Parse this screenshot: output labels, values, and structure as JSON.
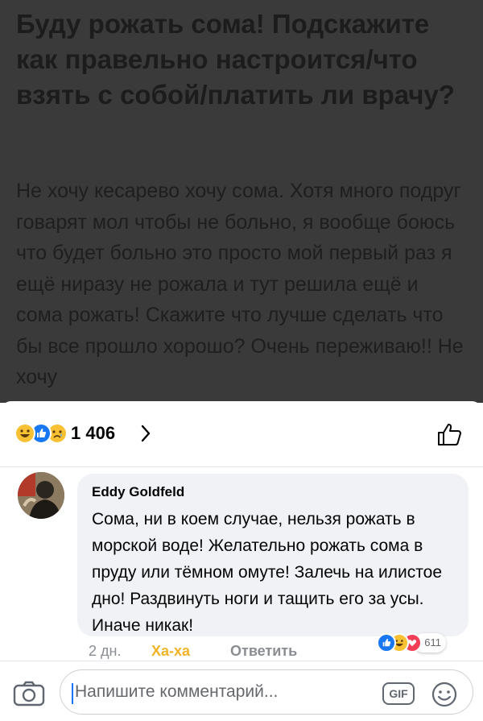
{
  "post": {
    "title": "Буду рожать сома! Подскажите как правельно настроится/что взять с собой/платить ли врачу?",
    "body": "Не хочу кесарево хочу сома. Хотя много подруг говарят мол чтобы не больно, я вообще боюсь что будет больно это просто мой первый раз я ещё ниразу не рожала и тут решила ещё и сома рожать! Скажите что лучше сделать что бы все прошло хорошо? Очень переживаю!! Не хочу"
  },
  "reactions": {
    "count": "1 406",
    "icons": [
      "haha-icon",
      "like-icon",
      "sad-icon"
    ]
  },
  "comment": {
    "author": "Eddy Goldfeld",
    "text": "Сома, ни в коем случае, нельзя рожать в морской воде! Желательно рожать сома в пруду или тёмном омуте! Залечь на илистое дно! Раздвинуть ноги и тащить его за усы. Иначе никак!",
    "time": "2 дн.",
    "reaction_label": "Ха-ха",
    "reply_label": "Ответить",
    "reaction_count": "611"
  },
  "composer": {
    "placeholder": "Напишите комментарий...",
    "gif_label": "GIF"
  },
  "colors": {
    "accent": "#1877f2",
    "haha": "#f0b429",
    "love": "#f33e58",
    "dim_overlay": "#3a3a3a"
  }
}
